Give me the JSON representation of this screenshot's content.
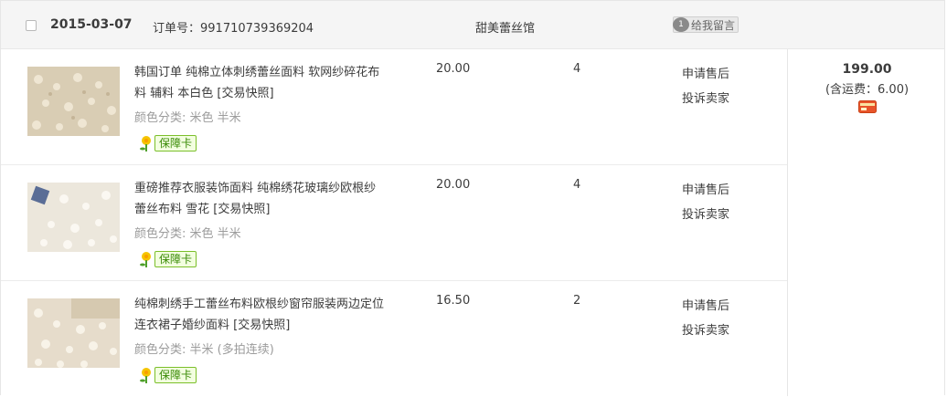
{
  "order": {
    "date": "2015-03-07",
    "order_label": "订单号：991710739369204",
    "shop_name": "甜美蕾丝馆",
    "message_button": "给我留言"
  },
  "items": [
    {
      "title": "韩国订单 纯棉立体刺绣蕾丝面料 软网纱碎花布料 辅料 本白色",
      "snapshot": "[交易快照]",
      "props": "颜色分类: 米色 半米",
      "guarantee": "保障卡",
      "price": "20.00",
      "qty": "4",
      "op1": "申请售后",
      "op2": "投诉卖家"
    },
    {
      "title": "重磅推荐衣服装饰面料 纯棉绣花玻璃纱欧根纱 蕾丝布料 雪花",
      "snapshot": "[交易快照]",
      "props": "颜色分类: 米色 半米",
      "guarantee": "保障卡",
      "price": "20.00",
      "qty": "4",
      "op1": "申请售后",
      "op2": "投诉卖家"
    },
    {
      "title": "纯棉刺绣手工蕾丝布料欧根纱窗帘服装两边定位连衣裙子婚纱面料",
      "snapshot": "[交易快照]",
      "props": "颜色分类: 半米 (多拍连续)",
      "guarantee": "保障卡",
      "price": "16.50",
      "qty": "2",
      "op1": "申请售后",
      "op2": "投诉卖家"
    }
  ],
  "summary": {
    "total": "199.00",
    "shipping": "(含运费：6.00)"
  },
  "colors": {
    "header_bg": "#f5f5f5",
    "text": "#3c3c3c",
    "muted": "#9c9c9c",
    "guarantee_green": "#3a8a06",
    "pay_icon": "#e8542a"
  },
  "icons": [
    "checkbox",
    "message-bubble-icon",
    "guarantee-flower-icon",
    "payment-card-icon"
  ]
}
